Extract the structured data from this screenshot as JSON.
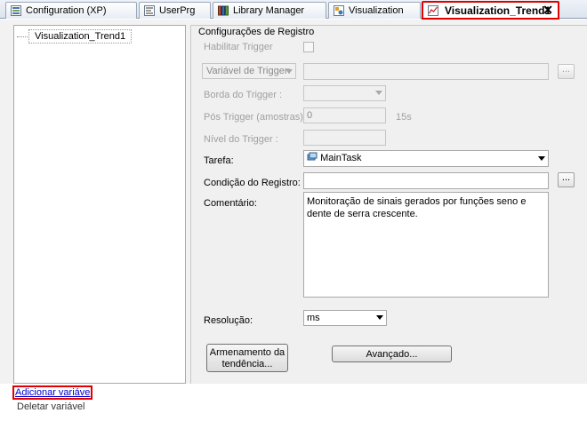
{
  "tabs": [
    {
      "label": "Configuration (XP)",
      "icon": "configuration-icon"
    },
    {
      "label": "UserPrg",
      "icon": "program-icon"
    },
    {
      "label": "Library Manager",
      "icon": "library-icon"
    },
    {
      "label": "Visualization",
      "icon": "visualization-icon"
    },
    {
      "label": "Visualization_Trend1",
      "icon": "trend-icon",
      "active": true,
      "close": "✕"
    }
  ],
  "tree": {
    "item": "Visualization_Trend1"
  },
  "config": {
    "group_title": "Configurações de Registro",
    "enable_trigger_label": "Habilitar Trigger",
    "trigger_var_label": "Variável de Trigger:",
    "trigger_edge_label": "Borda do Trigger :",
    "post_trigger_label": "Pós Trigger (amostras):",
    "post_trigger_value": "0",
    "post_trigger_unit": "15s",
    "trigger_level_label": "Nível do Trigger :",
    "task_label": "Tarefa:",
    "task_value": "MainTask",
    "record_condition_label": "Condição do Registro:",
    "comment_label": "Comentário:",
    "comment_value": "Monitoração de sinais gerados por funções seno e dente de serra crescente.",
    "resolution_label": "Resolução:",
    "resolution_value": "ms",
    "ellipsis": "...",
    "trend_storage_button": "Armenamento da tendência...",
    "advanced_button": "Avançado..."
  },
  "footer": {
    "add_variable": "Adicionar variáve",
    "delete_variable": "Deletar variável"
  },
  "colors": {
    "highlight": "#e00000",
    "link": "#0000cc"
  }
}
